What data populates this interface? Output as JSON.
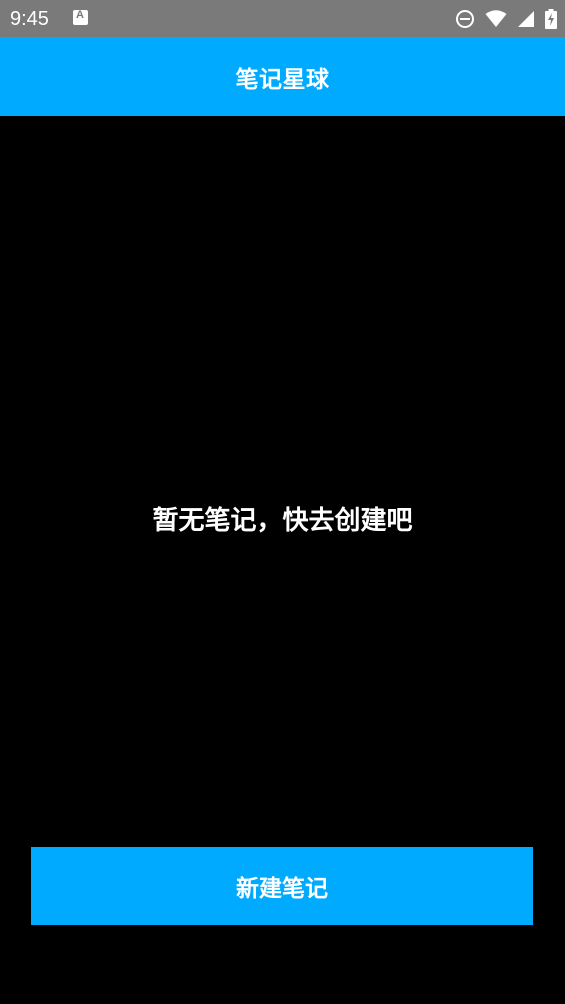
{
  "status_bar": {
    "time": "9:45",
    "notification_icon": "text-a-icon",
    "notification_icon_letter": "A",
    "icons": [
      "do-not-disturb-icon",
      "wifi-icon",
      "signal-icon",
      "battery-charging-icon"
    ],
    "background_color": "#7a7a7a"
  },
  "app_bar": {
    "title": "笔记星球",
    "background_color": "#00aaff"
  },
  "main": {
    "empty_message": "暂无笔记，快去创建吧",
    "background_color": "#000000"
  },
  "actions": {
    "create_note_label": "新建笔记",
    "button_color": "#00aaff"
  }
}
